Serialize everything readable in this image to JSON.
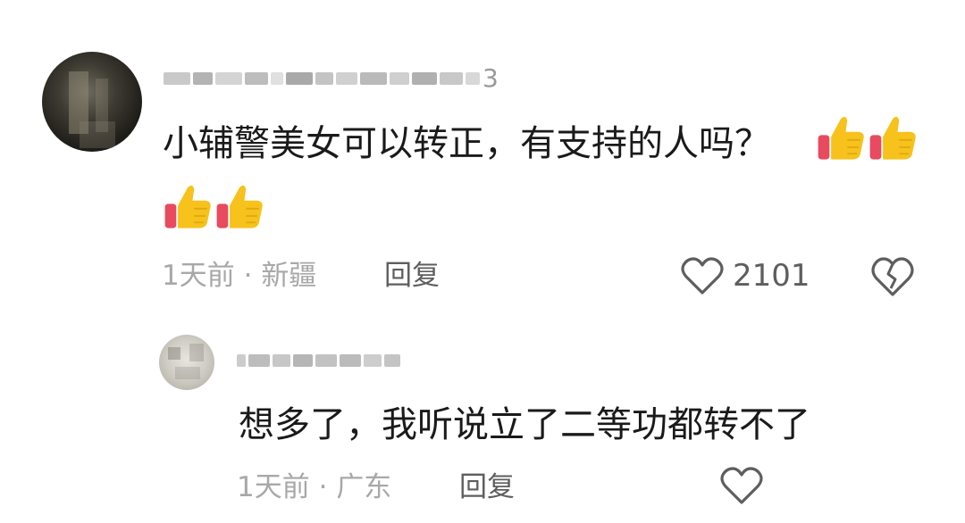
{
  "comment": {
    "username_tail": "3",
    "text": "小辅警美女可以转正，有支持的人吗？",
    "time": "1天前",
    "separator": "·",
    "location": "新疆",
    "reply_label": "回复",
    "like_count": "2101",
    "icons": [
      "thumbs-up-emoji",
      "heart-outline-icon",
      "broken-heart-icon"
    ]
  },
  "reply": {
    "text": "想多了，我听说立了二等功都转不了",
    "time": "1天前",
    "separator": "·",
    "location": "广东",
    "reply_label": "回复",
    "icons": [
      "heart-outline-icon"
    ]
  },
  "colors": {
    "text_primary": "#1a1a1a",
    "text_meta": "#a8a8a8",
    "text_action": "#5e5e5e",
    "thumb_yellow": "#f6c21b",
    "thumb_red": "#e84a5f"
  }
}
